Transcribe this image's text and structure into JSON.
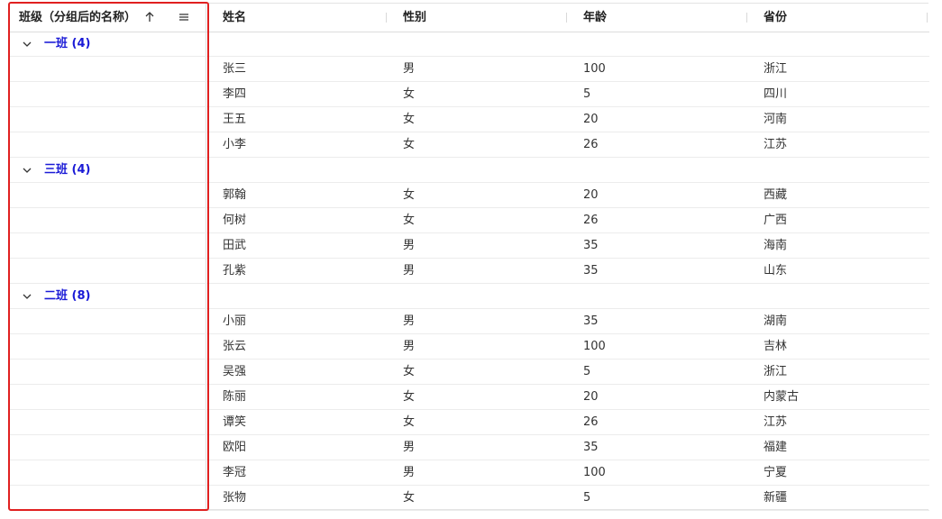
{
  "header": {
    "group_column": "班级（分组后的名称）",
    "columns": [
      "姓名",
      "性别",
      "年龄",
      "省份"
    ]
  },
  "groups": [
    {
      "label": "一班 (4)",
      "rows": [
        [
          "张三",
          "男",
          "100",
          "浙江"
        ],
        [
          "李四",
          "女",
          "5",
          "四川"
        ],
        [
          "王五",
          "女",
          "20",
          "河南"
        ],
        [
          "小李",
          "女",
          "26",
          "江苏"
        ]
      ]
    },
    {
      "label": "三班 (4)",
      "rows": [
        [
          "郭翰",
          "女",
          "20",
          "西藏"
        ],
        [
          "何树",
          "女",
          "26",
          "广西"
        ],
        [
          "田武",
          "男",
          "35",
          "海南"
        ],
        [
          "孔紫",
          "男",
          "35",
          "山东"
        ]
      ]
    },
    {
      "label": "二班 (8)",
      "rows": [
        [
          "小丽",
          "男",
          "35",
          "湖南"
        ],
        [
          "张云",
          "男",
          "100",
          "吉林"
        ],
        [
          "吴强",
          "女",
          "5",
          "浙江"
        ],
        [
          "陈丽",
          "女",
          "20",
          "内蒙古"
        ],
        [
          "谭笑",
          "女",
          "26",
          "江苏"
        ],
        [
          "欧阳",
          "男",
          "35",
          "福建"
        ],
        [
          "李冠",
          "男",
          "100",
          "宁夏"
        ],
        [
          "张物",
          "女",
          "5",
          "新疆"
        ]
      ]
    }
  ],
  "icons": {
    "sort": "arrow-up-icon",
    "menu": "menu-icon",
    "expand": "chevron-down-icon"
  },
  "colors": {
    "group_label": "#1a1ad6",
    "highlight_border": "#e02020"
  }
}
